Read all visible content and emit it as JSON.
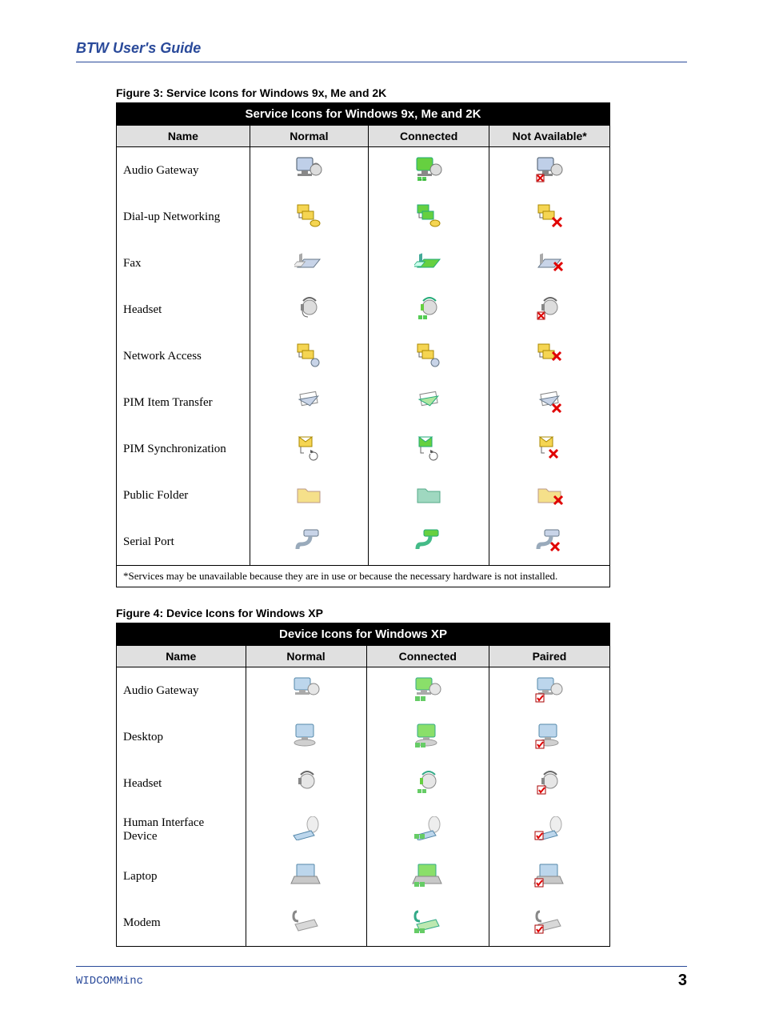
{
  "header": {
    "title": "BTW User's Guide"
  },
  "figure3": {
    "caption": "Figure 3: Service Icons for Windows 9x, Me and 2K",
    "tableTitle": "Service Icons for Windows 9x, Me and 2K",
    "columns": [
      "Name",
      "Normal",
      "Connected",
      "Not Available*"
    ],
    "rows": [
      {
        "name": "Audio Gateway"
      },
      {
        "name": "Dial-up Networking"
      },
      {
        "name": "Fax"
      },
      {
        "name": "Headset"
      },
      {
        "name": "Network Access"
      },
      {
        "name": "PIM Item Transfer"
      },
      {
        "name": "PIM Synchronization"
      },
      {
        "name": "Public Folder"
      },
      {
        "name": "Serial Port"
      }
    ],
    "footnote": "*Services may be unavailable because they are in use or because the necessary hardware is not installed."
  },
  "figure4": {
    "caption": "Figure 4: Device Icons for Windows XP",
    "tableTitle": "Device Icons for Windows XP",
    "columns": [
      "Name",
      "Normal",
      "Connected",
      "Paired"
    ],
    "rows": [
      {
        "name": "Audio Gateway"
      },
      {
        "name": "Desktop"
      },
      {
        "name": "Headset"
      },
      {
        "name": "Human Interface Device"
      },
      {
        "name": "Laptop"
      },
      {
        "name": "Modem"
      }
    ]
  },
  "footer": {
    "company": "WIDCOMMinc",
    "page": "3"
  },
  "icons": {
    "colors": {
      "normal": "#bfcfe8",
      "connected": "#66d040",
      "na_mark": "#e00000",
      "paired_mark": "#e00000",
      "folder_normal": "#f5e08a",
      "folder_connected": "#9fd8c0",
      "yellow": "#f5d552"
    }
  }
}
